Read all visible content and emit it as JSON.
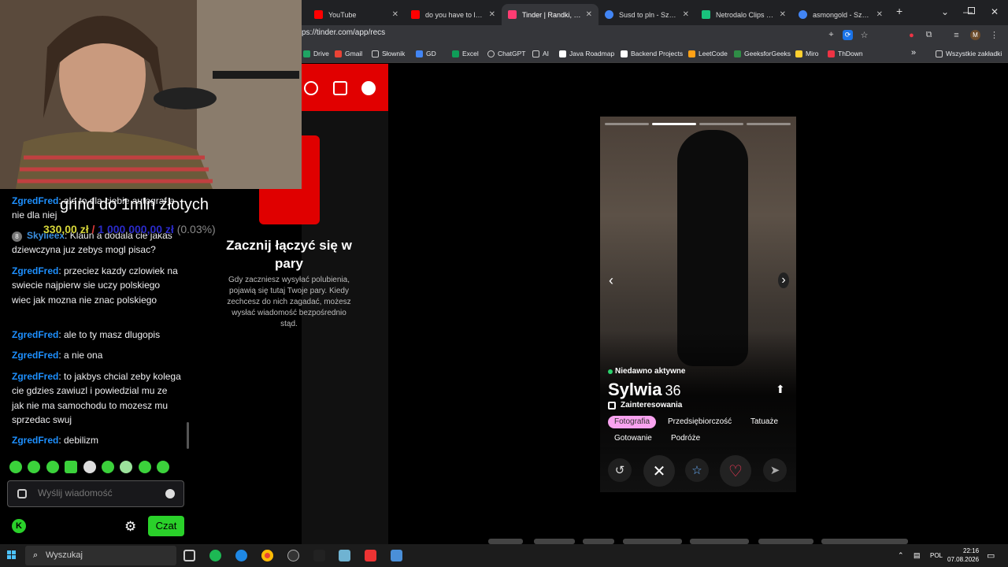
{
  "browser": {
    "tabs": [
      {
        "title": "YouTube",
        "color": "#ff0000"
      },
      {
        "title": "do you have to let it",
        "color": "#ff0000"
      },
      {
        "title": "Tinder | Randki, przy",
        "color": "#fe3c72"
      },
      {
        "title": "Susd to pln - Szukaj",
        "color": "#4285f4"
      },
      {
        "title": "Netrodalo Clips - Wa",
        "color": "#19c37d"
      },
      {
        "title": "asmongold - Szukaj",
        "color": "#4285f4"
      }
    ],
    "url": "ps://tinder.com/app/recs",
    "bookmarks": [
      "Drive",
      "Gmail",
      "Słownik",
      "GD",
      "Excel",
      "ChatGPT",
      "AI",
      "Java Roadmap",
      "Backend Projects",
      "LeetCode",
      "GeeksforGeeks",
      "Miro",
      "ThDown"
    ],
    "all_bookmarks": "Wszystkie zakładki"
  },
  "tinder": {
    "empty_title": "Zacznij łączyć się w pary",
    "empty_desc": "Gdy zaczniesz wysyłać polubienia, pojawią się tutaj Twoje pary. Kiedy zechcesz do nich zagadać, możesz wysłać wiadomość bezpośrednio stąd.",
    "profile": {
      "status": "Niedawno aktywne",
      "name": "Sylwia",
      "age": "36",
      "interests_label": "Zainteresowania",
      "tags": [
        "Fotografia",
        "Przedsiębiorczość",
        "Tatuaże",
        "Gotowanie",
        "Podróże"
      ]
    }
  },
  "stream": {
    "goal_text": "grind do 1mln złotych",
    "goal_current": "330,00 zł",
    "goal_sep": "/",
    "goal_target": "1 000 000,00 zł",
    "goal_pct": "(0.03%)",
    "chat": [
      {
        "user": "ZgredFred",
        "text": ": ale to dla ciebie autograf a nie dla niej"
      },
      {
        "user": "Skylleex",
        "text": ": Klaun a dodala cie jakas dziewczyna juz zebys mogl pisac?"
      },
      {
        "user": "ZgredFred",
        "text": ": przeciez kazdy czlowiek na swiecie najpierw sie uczy polskiego wiec jak mozna nie znac polskiego"
      },
      {
        "user": "ZgredFred",
        "text": ": ale to ty masz dlugopis"
      },
      {
        "user": "ZgredFred",
        "text": ": a nie ona"
      },
      {
        "user": "ZgredFred",
        "text": ": to jakbys chcial zeby kolega cie gdzies zawiuzl i powiedzial mu ze jak nie ma samochodu to mozesz mu sprzedac swuj"
      },
      {
        "user": "ZgredFred",
        "text": ": debilizm"
      }
    ],
    "badge": "8",
    "chat_placeholder": "Wyślij wiadomość",
    "send_label": "Czat"
  },
  "taskbar": {
    "search_placeholder": "Wyszukaj",
    "lang": "POL",
    "time": "22:16",
    "date": "07.08.2026"
  }
}
